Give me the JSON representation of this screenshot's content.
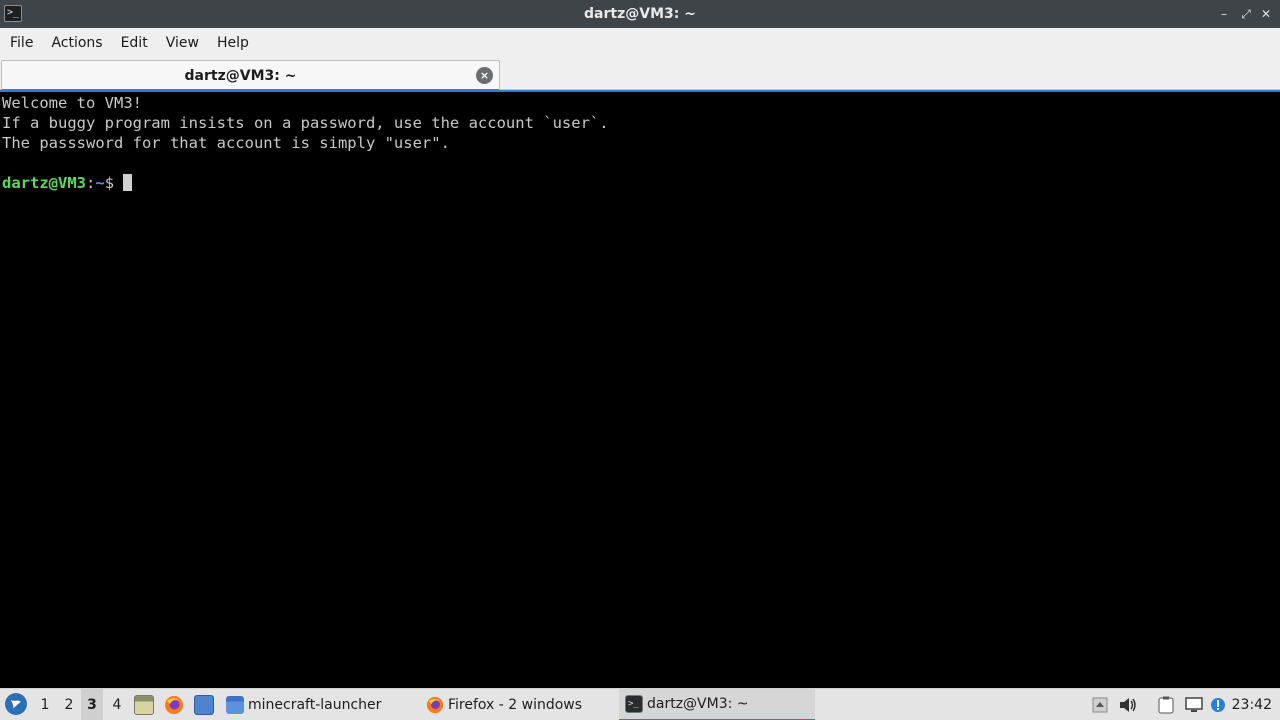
{
  "window": {
    "title": "dartz@VM3: ~",
    "app_icon_glyph": ">_",
    "controls": {
      "minimize": "–",
      "maximize": "⤢",
      "close": "✕"
    }
  },
  "menubar": {
    "items": [
      "File",
      "Actions",
      "Edit",
      "View",
      "Help"
    ]
  },
  "tabs": [
    {
      "label": "dartz@VM3: ~",
      "close_glyph": "×"
    }
  ],
  "terminal": {
    "lines": [
      "Welcome to VM3!",
      "If a buggy program insists on a password, use the account `user`.",
      "The passsword for that account is simply \"user\"."
    ],
    "prompt": {
      "user_host": "dartz@VM3",
      "path_sep": ":",
      "path": "~",
      "symbol": "$"
    }
  },
  "taskbar": {
    "workspaces": [
      "1",
      "2",
      "3",
      "4"
    ],
    "active_workspace": "3",
    "tasks": [
      {
        "label": "minecraft-launcher",
        "icon": "folder-icon"
      },
      {
        "label": "Firefox - 2 windows",
        "icon": "firefox-icon"
      },
      {
        "label": "dartz@VM3: ~",
        "icon": "terminal-icon"
      }
    ],
    "clock": "23:42"
  },
  "colors": {
    "accent": "#2d7dd2",
    "prompt_user": "#5ed85e",
    "prompt_path": "#6b8fe0",
    "terminal_bg": "#000000",
    "terminal_fg": "#c8c8c8"
  }
}
